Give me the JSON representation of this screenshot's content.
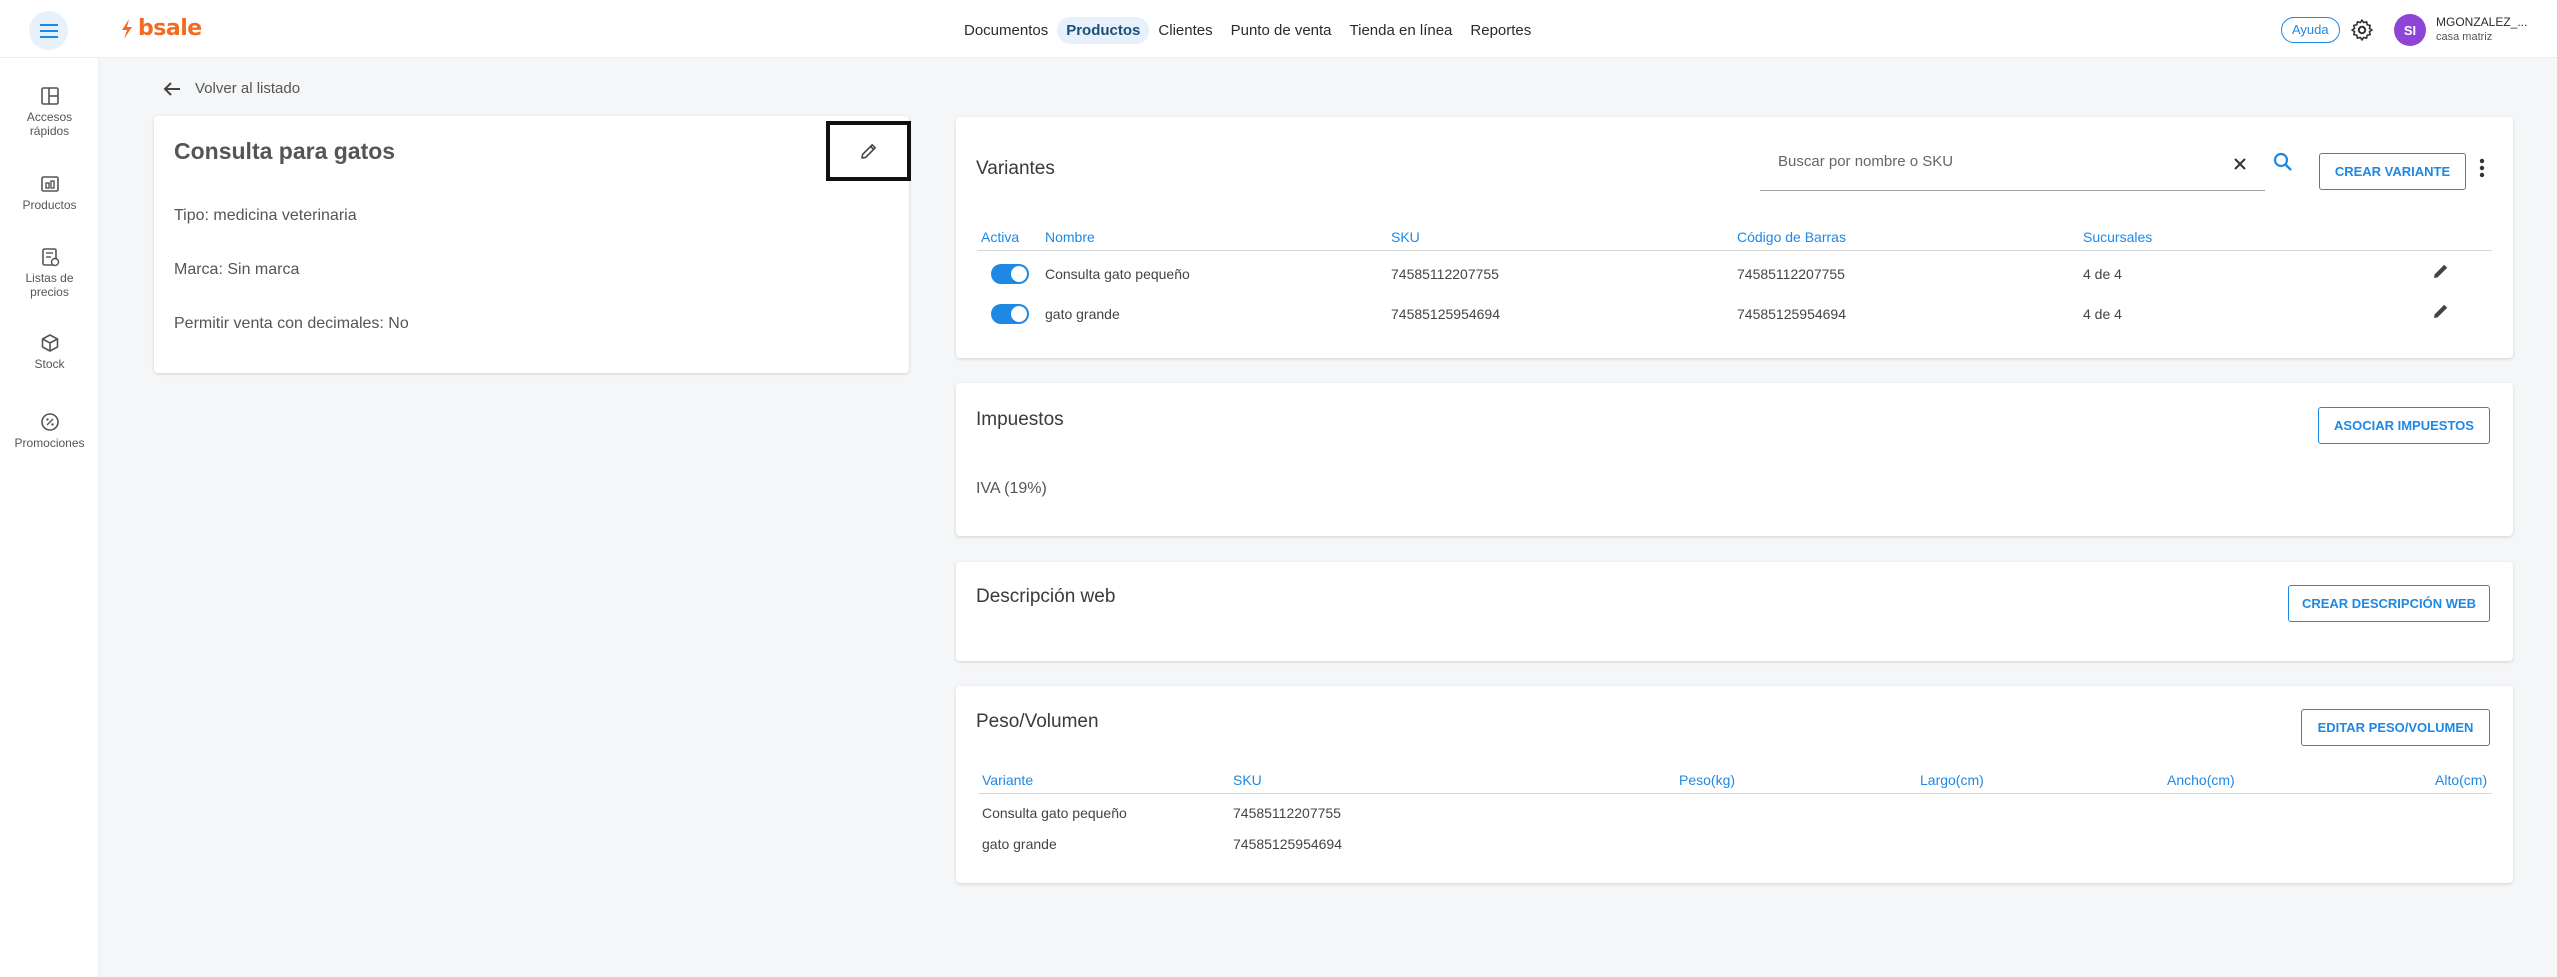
{
  "brand": {
    "name": "bsale",
    "accent": "#f26b21",
    "primary": "#1e88e5"
  },
  "topnav": {
    "items": [
      {
        "label": "Documentos"
      },
      {
        "label": "Productos",
        "active": true
      },
      {
        "label": "Clientes"
      },
      {
        "label": "Punto de venta"
      },
      {
        "label": "Tienda en línea"
      },
      {
        "label": "Reportes"
      }
    ],
    "help_label": "Ayuda",
    "avatar_initials": "SI",
    "user_name": "MGONZALEZ_...",
    "user_branch": "casa matriz"
  },
  "sidebar": {
    "items": [
      {
        "label": "Accesos rápidos",
        "icon": "layout-icon"
      },
      {
        "label": "Productos",
        "icon": "products-icon"
      },
      {
        "label": "Listas de precios",
        "icon": "price-list-icon"
      },
      {
        "label": "Stock",
        "icon": "box-icon"
      },
      {
        "label": "Promociones",
        "icon": "promo-icon"
      }
    ]
  },
  "back_label": "Volver al listado",
  "product": {
    "name": "Consulta para gatos",
    "type_line": "Tipo: medicina veterinaria",
    "brand_line": "Marca: Sin marca",
    "decimals_line": "Permitir venta con decimales: No"
  },
  "variants": {
    "title": "Variantes",
    "search_placeholder": "Buscar por nombre o SKU",
    "create_label": "CREAR VARIANTE",
    "columns": [
      "Activa",
      "Nombre",
      "SKU",
      "Código de Barras",
      "Sucursales"
    ],
    "rows": [
      {
        "active": true,
        "name": "Consulta gato pequeño",
        "sku": "74585112207755",
        "barcode": "74585112207755",
        "branches": "4 de 4"
      },
      {
        "active": true,
        "name": "gato grande",
        "sku": "74585125954694",
        "barcode": "74585125954694",
        "branches": "4 de 4"
      }
    ]
  },
  "taxes": {
    "title": "Impuestos",
    "button_label": "ASOCIAR IMPUESTOS",
    "items": [
      "IVA (19%)"
    ]
  },
  "web_description": {
    "title": "Descripción web",
    "button_label": "CREAR DESCRIPCIÓN WEB"
  },
  "weight_volume": {
    "title": "Peso/Volumen",
    "button_label": "EDITAR PESO/VOLUMEN",
    "columns": [
      "Variante",
      "SKU",
      "Peso(kg)",
      "Largo(cm)",
      "Ancho(cm)",
      "Alto(cm)"
    ],
    "rows": [
      {
        "variant": "Consulta gato pequeño",
        "sku": "74585112207755"
      },
      {
        "variant": "gato grande",
        "sku": "74585125954694"
      }
    ]
  }
}
